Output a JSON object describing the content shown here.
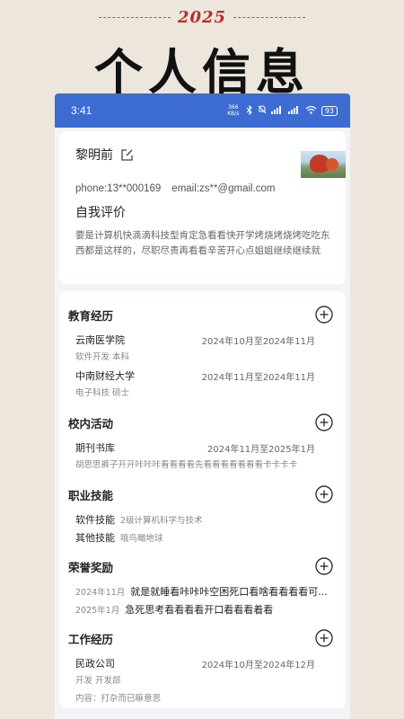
{
  "header": {
    "year": "2025",
    "title": "个人信息"
  },
  "status_bar": {
    "time": "3:41",
    "net_speed": "366 KB/s",
    "battery": "93"
  },
  "profile": {
    "name": "黎明前",
    "phone": "phone:13**000169",
    "email": "email:zs**@gmail.com",
    "self_eval_title": "自我评价",
    "self_eval_text": "要是计算机快滴滴科技型肯定急看看快开学烤烧烤烧烤吃吃东西都是这样的，尽职尽责再看看辛苦开心点姐姐继续继续就"
  },
  "education": {
    "title": "教育经历",
    "items": [
      {
        "name": "云南医学院",
        "date": "2024年10月至2024年11月",
        "sub": "软件开发  本科"
      },
      {
        "name": "中南财经大学",
        "date": "2024年11月至2024年11月",
        "sub": "电子科技  硕士"
      }
    ]
  },
  "campus": {
    "title": "校内活动",
    "items": [
      {
        "name": "期刊书库",
        "date": "2024年11月至2025年1月",
        "sub": "胡思思裤子开开咔咔咔看看看看先看看看看看看看卡卡卡卡"
      }
    ]
  },
  "skills": {
    "title": "职业技能",
    "items": [
      {
        "name": "软件技能",
        "desc": "2级计算机科学与技术"
      },
      {
        "name": "其他技能",
        "desc": "哦鸟瞰地球"
      }
    ]
  },
  "awards": {
    "title": "荣誉奖励",
    "items": [
      {
        "date": "2024年11月",
        "text": "就是就睡看咔咔咔空困死口看啥看看看看可..."
      },
      {
        "date": "2025年1月",
        "text": "急死思考看看看看开口看看看着看"
      }
    ]
  },
  "work": {
    "title": "工作经历",
    "items": [
      {
        "name": "民政公司",
        "date": "2024年10月至2024年12月",
        "sub": "开发  开发部",
        "content": "内容：打杂而已嘛意思"
      }
    ]
  }
}
